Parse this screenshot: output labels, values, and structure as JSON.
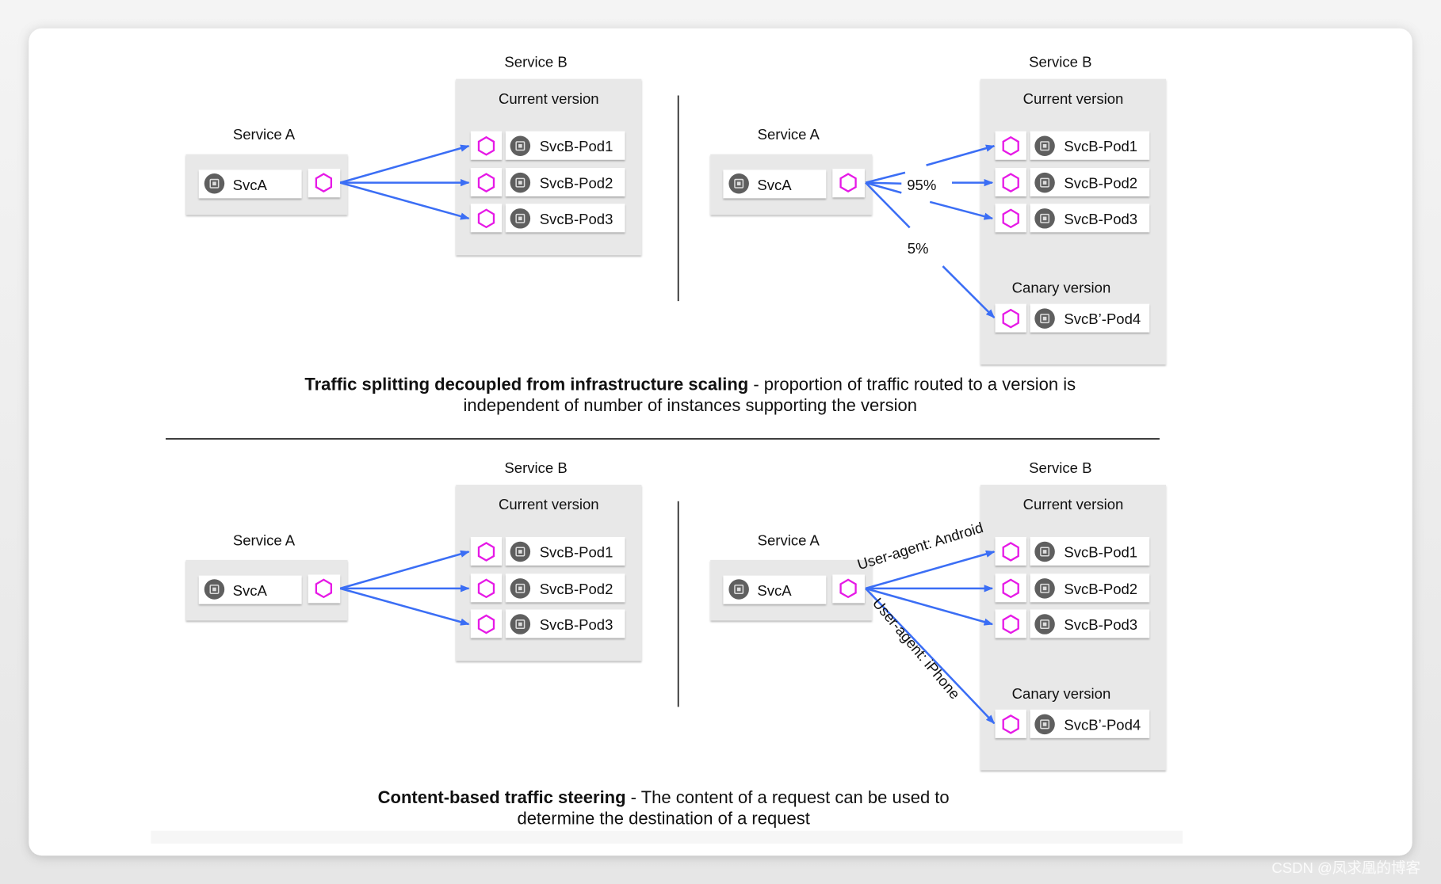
{
  "colors": {
    "arrow": "#3b6ef5",
    "sidecar": "#e619e6",
    "box": "#e8e8e8",
    "icon": "#5f5f5f"
  },
  "panels": [
    {
      "service_a": "Service A",
      "svca": "SvcA",
      "service_b": "Service B",
      "current_version": "Current version",
      "pods": [
        "SvcB-Pod1",
        "SvcB-Pod2",
        "SvcB-Pod3"
      ]
    },
    {
      "service_a": "Service A",
      "svca": "SvcA",
      "service_b": "Service B",
      "current_version": "Current version",
      "pods": [
        "SvcB-Pod1",
        "SvcB-Pod2",
        "SvcB-Pod3"
      ],
      "canary_version": "Canary  version",
      "canary_pod": "SvcB’-Pod4",
      "split_main": "95%",
      "split_canary": "5%"
    },
    {
      "service_a": "Service A",
      "svca": "SvcA",
      "service_b": "Service B",
      "current_version": "Current version",
      "pods": [
        "SvcB-Pod1",
        "SvcB-Pod2",
        "SvcB-Pod3"
      ]
    },
    {
      "service_a": "Service A",
      "svca": "SvcA",
      "service_b": "Service B",
      "current_version": "Current version",
      "pods": [
        "SvcB-Pod1",
        "SvcB-Pod2",
        "SvcB-Pod3"
      ],
      "canary_version": "Canary  version",
      "canary_pod": "SvcB’-Pod4",
      "route_main": "User-agent: Android",
      "route_canary": "User-agent: iPhone"
    }
  ],
  "captions": {
    "top": {
      "bold": "Traffic splitting decoupled from infrastructure scaling",
      "rest": " - proportion of traffic routed to a version is",
      "line2": "independent of number of instances supporting the version"
    },
    "bottom": {
      "bold": "Content-based traffic steering",
      "rest": " - The content of a request can be used to",
      "line2": "determine the destination of a request"
    }
  },
  "watermark": "CSDN @凤求凰的博客"
}
